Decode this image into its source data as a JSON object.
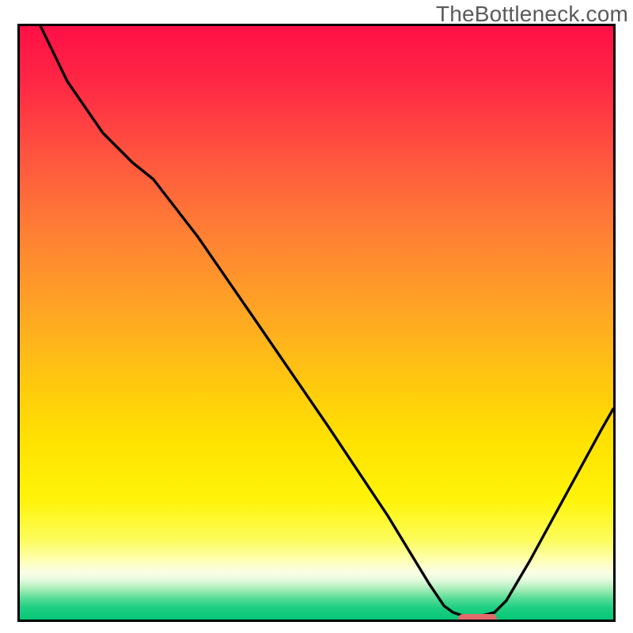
{
  "watermark": "TheBottleneck.com",
  "colors": {
    "stroke": "#000000",
    "marker_fill": "#e16a6a",
    "border": "#000000"
  },
  "gradient_stops": [
    {
      "pct": 0,
      "color": "#ff0f46"
    },
    {
      "pct": 10,
      "color": "#ff2944"
    },
    {
      "pct": 22,
      "color": "#ff553f"
    },
    {
      "pct": 35,
      "color": "#ff8034"
    },
    {
      "pct": 48,
      "color": "#ffa524"
    },
    {
      "pct": 60,
      "color": "#ffc80f"
    },
    {
      "pct": 70,
      "color": "#ffe200"
    },
    {
      "pct": 80,
      "color": "#fff40a"
    },
    {
      "pct": 86.5,
      "color": "#fcfc5a"
    },
    {
      "pct": 90,
      "color": "#fefeb3"
    },
    {
      "pct": 92,
      "color": "#fafee4"
    },
    {
      "pct": 93.2,
      "color": "#e7fbdf"
    },
    {
      "pct": 94.2,
      "color": "#c3f3c9"
    },
    {
      "pct": 95.2,
      "color": "#96eab0"
    },
    {
      "pct": 96.5,
      "color": "#54dc96"
    },
    {
      "pct": 98,
      "color": "#1fcf82"
    },
    {
      "pct": 100,
      "color": "#05c777"
    }
  ],
  "chart_data": {
    "type": "line",
    "x_range": [
      0,
      100
    ],
    "y_range": [
      0,
      100
    ],
    "xlabel": "",
    "ylabel": "",
    "title": "",
    "series": [
      {
        "name": "bottleneck-curve",
        "points": [
          {
            "x": 3.5,
            "y": 100
          },
          {
            "x": 8,
            "y": 90.7
          },
          {
            "x": 14,
            "y": 82
          },
          {
            "x": 19,
            "y": 77
          },
          {
            "x": 22.5,
            "y": 74.2
          },
          {
            "x": 30,
            "y": 64.5
          },
          {
            "x": 40,
            "y": 50
          },
          {
            "x": 52,
            "y": 32.5
          },
          {
            "x": 62,
            "y": 17.5
          },
          {
            "x": 69,
            "y": 6
          },
          {
            "x": 71.5,
            "y": 2.3
          },
          {
            "x": 73,
            "y": 1.2
          },
          {
            "x": 74.5,
            "y": 0.7
          },
          {
            "x": 78,
            "y": 0.7
          },
          {
            "x": 80,
            "y": 1.2
          },
          {
            "x": 82,
            "y": 3.2
          },
          {
            "x": 86,
            "y": 10
          },
          {
            "x": 92,
            "y": 21
          },
          {
            "x": 98,
            "y": 32
          },
          {
            "x": 100,
            "y": 35.5
          }
        ]
      }
    ],
    "marker": {
      "x_center": 76.5,
      "y": 0.9,
      "width_pct": 6.5,
      "height_pct": 1.6
    }
  }
}
